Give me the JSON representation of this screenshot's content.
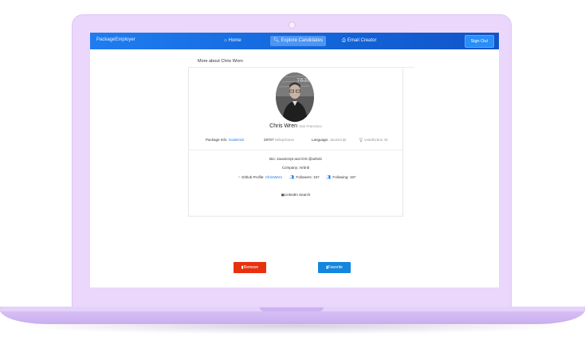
{
  "navbar": {
    "brand": "PackageEmployer",
    "home_label": "Home",
    "explore_label": "Explore Candidates",
    "email_label": "Email Creator",
    "signout_label": "Sign Out"
  },
  "panel": {
    "title": "More about Chris Wren"
  },
  "profile": {
    "name": "Chris Wren",
    "location": "San Francisco",
    "package_label": "Package Info:",
    "package_value": "modernizr",
    "downloads_value": "29707",
    "downloads_label": "Ndwpsloavs",
    "language_label": "Language:",
    "language_value": "JavaScript",
    "rank_label": "usetdbzdne 40",
    "bio": "Bio: JavaScript and iOS @airbnb",
    "company": "Company: Airbnb",
    "github_label": "Github Profile:",
    "github_value": "ChrisWren",
    "followers": "Followers: 167",
    "following": "Following: 197",
    "linkedin_label": "LinkedIn Search"
  },
  "actions": {
    "remove_label": "Remove",
    "favorite_label": "Favorite"
  },
  "colors": {
    "nav": "#1264d8",
    "remove": "#e8310f",
    "favorite": "#1486de",
    "link": "#1a76e6",
    "laptop": "#ead7fb"
  },
  "icons": {
    "home": "home-icon",
    "explore": "search-icon",
    "email": "printer-icon",
    "github": "github-icon",
    "followers": "users-icon",
    "linkedin": "linkedin-icon",
    "remove": "trash-icon",
    "favorite": "bookmark-icon"
  }
}
